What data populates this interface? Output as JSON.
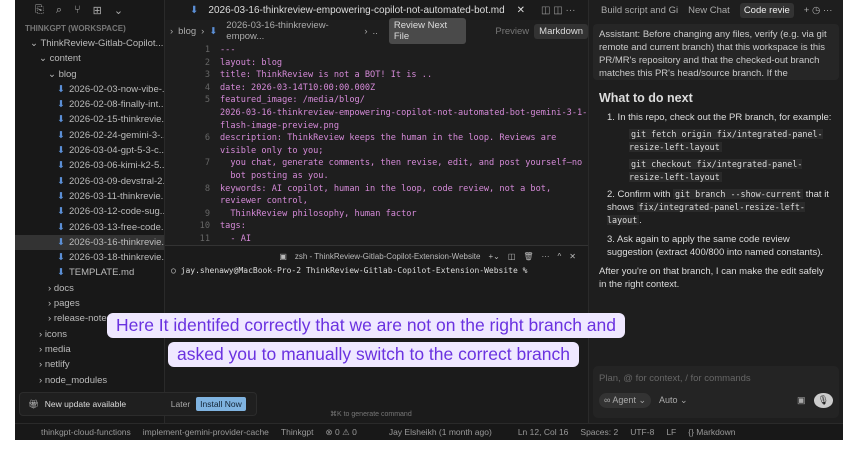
{
  "sidebar": {
    "workspace": "THINKGPT (WORKSPACE)",
    "items": [
      {
        "label": "ThinkReview-Gitlab-Copilot...",
        "type": "folder",
        "depth": 1
      },
      {
        "label": "content",
        "type": "folder",
        "depth": 2
      },
      {
        "label": "blog",
        "type": "folder",
        "depth": 3
      },
      {
        "label": "2026-02-03-now-vibe-...",
        "type": "file",
        "depth": 4
      },
      {
        "label": "2026-02-08-finally-int...",
        "type": "file",
        "depth": 4
      },
      {
        "label": "2026-02-15-thinkrevie...",
        "type": "file",
        "depth": 4
      },
      {
        "label": "2026-02-24-gemini-3-...",
        "type": "file",
        "depth": 4
      },
      {
        "label": "2026-03-04-gpt-5-3-c...",
        "type": "file",
        "depth": 4
      },
      {
        "label": "2026-03-06-kimi-k2-5...",
        "type": "file",
        "depth": 4
      },
      {
        "label": "2026-03-09-devstral-2...",
        "type": "file",
        "depth": 4
      },
      {
        "label": "2026-03-11-thinkrevie...",
        "type": "file",
        "depth": 4
      },
      {
        "label": "2026-03-12-code-sug...",
        "type": "file",
        "depth": 4
      },
      {
        "label": "2026-03-13-free-code...",
        "type": "file",
        "depth": 4
      },
      {
        "label": "2026-03-16-thinkrevie...",
        "type": "file",
        "depth": 4,
        "selected": true
      },
      {
        "label": "2026-03-18-thinkrevie...",
        "type": "file",
        "depth": 4
      },
      {
        "label": "TEMPLATE.md",
        "type": "file",
        "depth": 4
      },
      {
        "label": "docs",
        "type": "folder",
        "depth": 3,
        "collapsed": true
      },
      {
        "label": "pages",
        "type": "folder",
        "depth": 3,
        "collapsed": true
      },
      {
        "label": "release-notes",
        "type": "folder",
        "depth": 3,
        "collapsed": true
      },
      {
        "label": "icons",
        "type": "folder",
        "depth": 2,
        "collapsed": true
      },
      {
        "label": "media",
        "type": "folder",
        "depth": 2,
        "collapsed": true
      },
      {
        "label": "netlify",
        "type": "folder",
        "depth": 2,
        "collapsed": true
      },
      {
        "label": "node_modules",
        "type": "folder",
        "depth": 2,
        "collapsed": true
      }
    ],
    "update": {
      "text": "New update available",
      "later": "Later",
      "install": "Install Now"
    }
  },
  "editor": {
    "tab": "2026-03-16-thinkreview-empowering-copilot-not-automated-bot.md",
    "breadcrumb": [
      "blog",
      "2026-03-16-thinkreview-empow...",
      ".."
    ],
    "review_next": "Review Next File",
    "preview": "Preview",
    "markdown": "Markdown",
    "lines": [
      {
        "n": "1",
        "t": "---"
      },
      {
        "n": "2",
        "t": "layout: blog"
      },
      {
        "n": "3",
        "t": "title: ThinkReview is not a BOT! It is .."
      },
      {
        "n": "4",
        "t": "date: 2026-03-14T10:00:00.000Z"
      },
      {
        "n": "5",
        "t": "featured_image: /media/blog/"
      },
      {
        "n": "",
        "t": "2026-03-16-thinkreview-empowering-copilot-not-automated-bot-gemini-3-1-"
      },
      {
        "n": "",
        "t": "flash-image-preview.png"
      },
      {
        "n": "6",
        "t": "description: ThinkReview keeps the human in the loop. Reviews are"
      },
      {
        "n": "",
        "t": "visible only to you;"
      },
      {
        "n": "7",
        "t": "  you chat, generate comments, then revise, edit, and post yourself—no"
      },
      {
        "n": "",
        "t": "  bot posting as you."
      },
      {
        "n": "8",
        "t": "keywords: AI copilot, human in the loop, code review, not a bot,"
      },
      {
        "n": "",
        "t": "reviewer control,"
      },
      {
        "n": "9",
        "t": "  ThinkReview philosophy, human factor"
      },
      {
        "n": "10",
        "t": "tags:"
      },
      {
        "n": "11",
        "t": "  - AI"
      }
    ]
  },
  "terminal": {
    "title": "zsh - ThinkReview-Gitlab-Copilot-Extension-Website",
    "prompt": "jay.shenawy@MacBook-Pro-2 ThinkReview-Gitlab-Copilot-Extension-Website %",
    "hint": "⌘K to generate command"
  },
  "chat": {
    "tabs": [
      "Build script and Gi",
      "New Chat",
      "Code revie"
    ],
    "query": "Assistant: Before changing any files, verify (e.g. via git remote and current branch) that this workspace is this PR/MR's repository and that the checked-out branch matches this PR's head/source branch. If the workspace",
    "heading": "What to do next",
    "step1": "1. In this repo, check out the PR branch, for example:",
    "cmd1": "git fetch origin fix/integrated-panel-resize-left-layout",
    "cmd2": "git checkout fix/integrated-panel-resize-left-layout",
    "step2a": "2. Confirm with",
    "cmd3": "git branch --show-current",
    "step2b": "that it shows",
    "cmd4": "fix/integrated-panel-resize-left-layout",
    "step2c": ".",
    "step3": "3. Ask again to apply the same code review suggestion (extract 400/800 into named constants).",
    "after": "After you're on that branch, I can make the edit safely in the right context.",
    "input_placeholder": "Plan, @ for context, / for commands",
    "mode": "Agent",
    "model": "Auto"
  },
  "status": {
    "remote": "thinkgpt-cloud-functions",
    "branch": "implement-gemini-provider-cache",
    "project": "Thinkgpt",
    "problems": "⊗ 0 ⚠ 0",
    "blame": "Jay Elsheikh (1 month ago)",
    "position": "Ln 12, Col 16",
    "spaces": "Spaces: 2",
    "encoding": "UTF-8",
    "eol": "LF",
    "language": "{} Markdown"
  },
  "caption": {
    "line1": "Here It identifed correctly that we are not on the right branch and",
    "line2": "asked you to manually switch to the correct branch"
  }
}
